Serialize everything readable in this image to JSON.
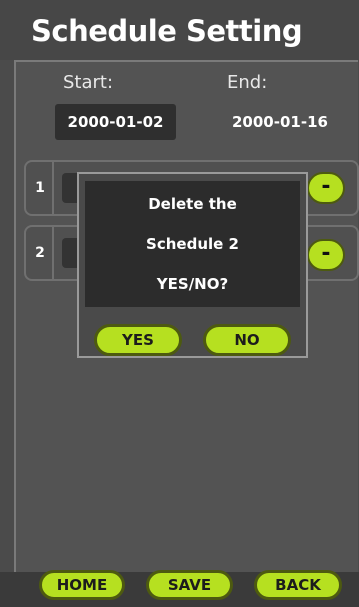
{
  "header": {
    "title": "Schedule Setting"
  },
  "dates": {
    "start_label": "Start:",
    "start_value": "2000-01-02",
    "end_label": "End:",
    "end_value": "2000-01-16"
  },
  "schedules": [
    {
      "number": "1",
      "action_icon": "minus-icon",
      "action_label": "-"
    },
    {
      "number": "2",
      "action_icon": "minus-icon",
      "action_label": "-"
    }
  ],
  "dialog": {
    "line1": "Delete the",
    "line2": "Schedule 2",
    "line3": "YES/NO?",
    "yes_label": "YES",
    "no_label": "NO"
  },
  "footer": {
    "home_label": "HOME",
    "save_label": "SAVE",
    "back_label": "BACK"
  },
  "colors": {
    "accent": "#b6e020",
    "background": "#4b4b4b",
    "dialog_background": "#2c2c2c"
  }
}
